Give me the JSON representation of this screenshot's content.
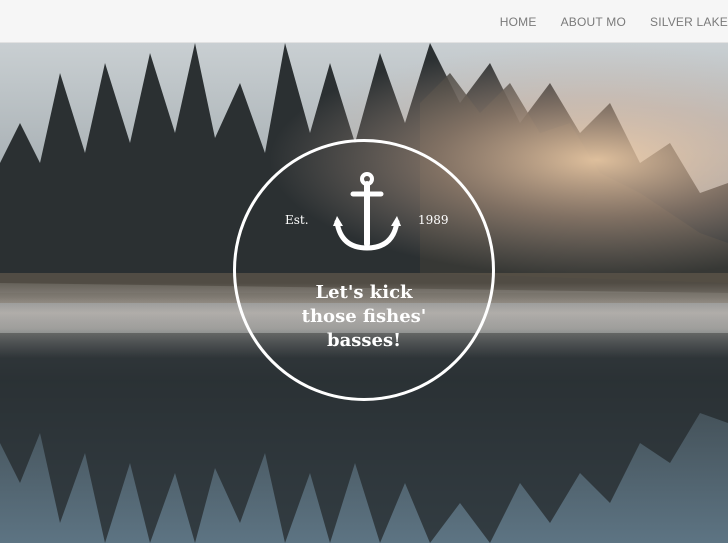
{
  "nav": {
    "items": [
      {
        "label": "HOME"
      },
      {
        "label": "ABOUT MO"
      },
      {
        "label": "SILVER LAKE"
      }
    ]
  },
  "hero": {
    "badge": {
      "est_label": "Est.",
      "year": "1989",
      "icon": "anchor-icon",
      "tagline": [
        "Let's kick",
        "those fishes'",
        "basses!"
      ]
    }
  },
  "colors": {
    "nav_bg": "#f6f6f6",
    "nav_text": "#7a7a7a",
    "badge": "#ffffff"
  }
}
